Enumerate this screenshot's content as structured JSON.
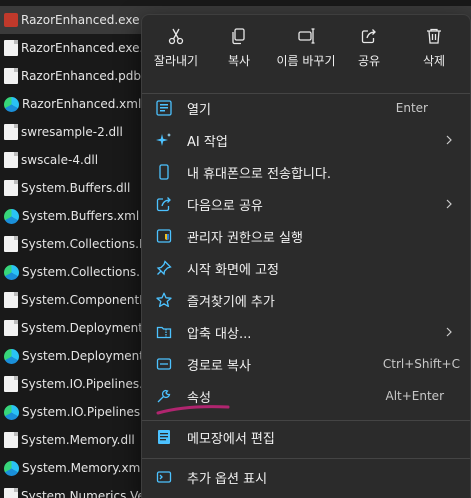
{
  "files": [
    {
      "name": "RazorEnhanced.exe",
      "icon": "exe-icon",
      "selected": true
    },
    {
      "name": "RazorEnhanced.exe.config",
      "icon": "document-icon"
    },
    {
      "name": "RazorEnhanced.pdb",
      "icon": "document-icon"
    },
    {
      "name": "RazorEnhanced.xml",
      "icon": "edge-icon"
    },
    {
      "name": "swresample-2.dll",
      "icon": "document-icon"
    },
    {
      "name": "swscale-4.dll",
      "icon": "document-icon"
    },
    {
      "name": "System.Buffers.dll",
      "icon": "document-icon"
    },
    {
      "name": "System.Buffers.xml",
      "icon": "edge-icon"
    },
    {
      "name": "System.Collections.Immutable.dll",
      "icon": "document-icon"
    },
    {
      "name": "System.Collections.Immutable.xml",
      "icon": "edge-icon"
    },
    {
      "name": "System.ComponentModel.dll",
      "icon": "document-icon"
    },
    {
      "name": "System.Deployment.dll",
      "icon": "document-icon"
    },
    {
      "name": "System.Deployment.xml",
      "icon": "edge-icon"
    },
    {
      "name": "System.IO.Pipelines.dll",
      "icon": "document-icon"
    },
    {
      "name": "System.IO.Pipelines.xml",
      "icon": "edge-icon"
    },
    {
      "name": "System.Memory.dll",
      "icon": "document-icon"
    },
    {
      "name": "System.Memory.xml",
      "icon": "edge-icon"
    },
    {
      "name": "System.Numerics.Vectors.dll",
      "icon": "document-icon"
    }
  ],
  "quick_actions": [
    {
      "label": "잘라내기",
      "icon": "scissors-icon"
    },
    {
      "label": "복사",
      "icon": "copy-icon"
    },
    {
      "label": "이름 바꾸기",
      "icon": "rename-icon"
    },
    {
      "label": "공유",
      "icon": "share-icon"
    },
    {
      "label": "삭제",
      "icon": "trash-icon"
    }
  ],
  "menu_items": [
    {
      "label": "열기",
      "shortcut": "Enter",
      "icon": "open-icon"
    },
    {
      "label": "AI 작업",
      "submenu": true,
      "icon": "sparkle-icon"
    },
    {
      "label": "내 휴대폰으로 전송합니다.",
      "icon": "phone-icon"
    },
    {
      "label": "다음으로 공유",
      "submenu": true,
      "icon": "share-icon"
    },
    {
      "label": "관리자 권한으로 실행",
      "icon": "shield-icon"
    },
    {
      "label": "시작 화면에 고정",
      "icon": "pin-icon"
    },
    {
      "label": "즐겨찾기에 추가",
      "icon": "star-icon"
    },
    {
      "label": "압축 대상...",
      "submenu": true,
      "icon": "folder-zip-icon"
    },
    {
      "label": "경로로 복사",
      "shortcut": "Ctrl+Shift+C",
      "icon": "path-copy-icon"
    },
    {
      "label": "속성",
      "shortcut": "Alt+Enter",
      "icon": "wrench-icon"
    },
    {
      "label": "메모장에서 편집",
      "icon": "notepad-icon"
    },
    {
      "label": "추가 옵션 표시",
      "icon": "more-options-icon"
    }
  ],
  "colors": {
    "accent": "#4cc2ff",
    "annotation": "#b0256f",
    "menu_bg": "#2b2b2b"
  }
}
